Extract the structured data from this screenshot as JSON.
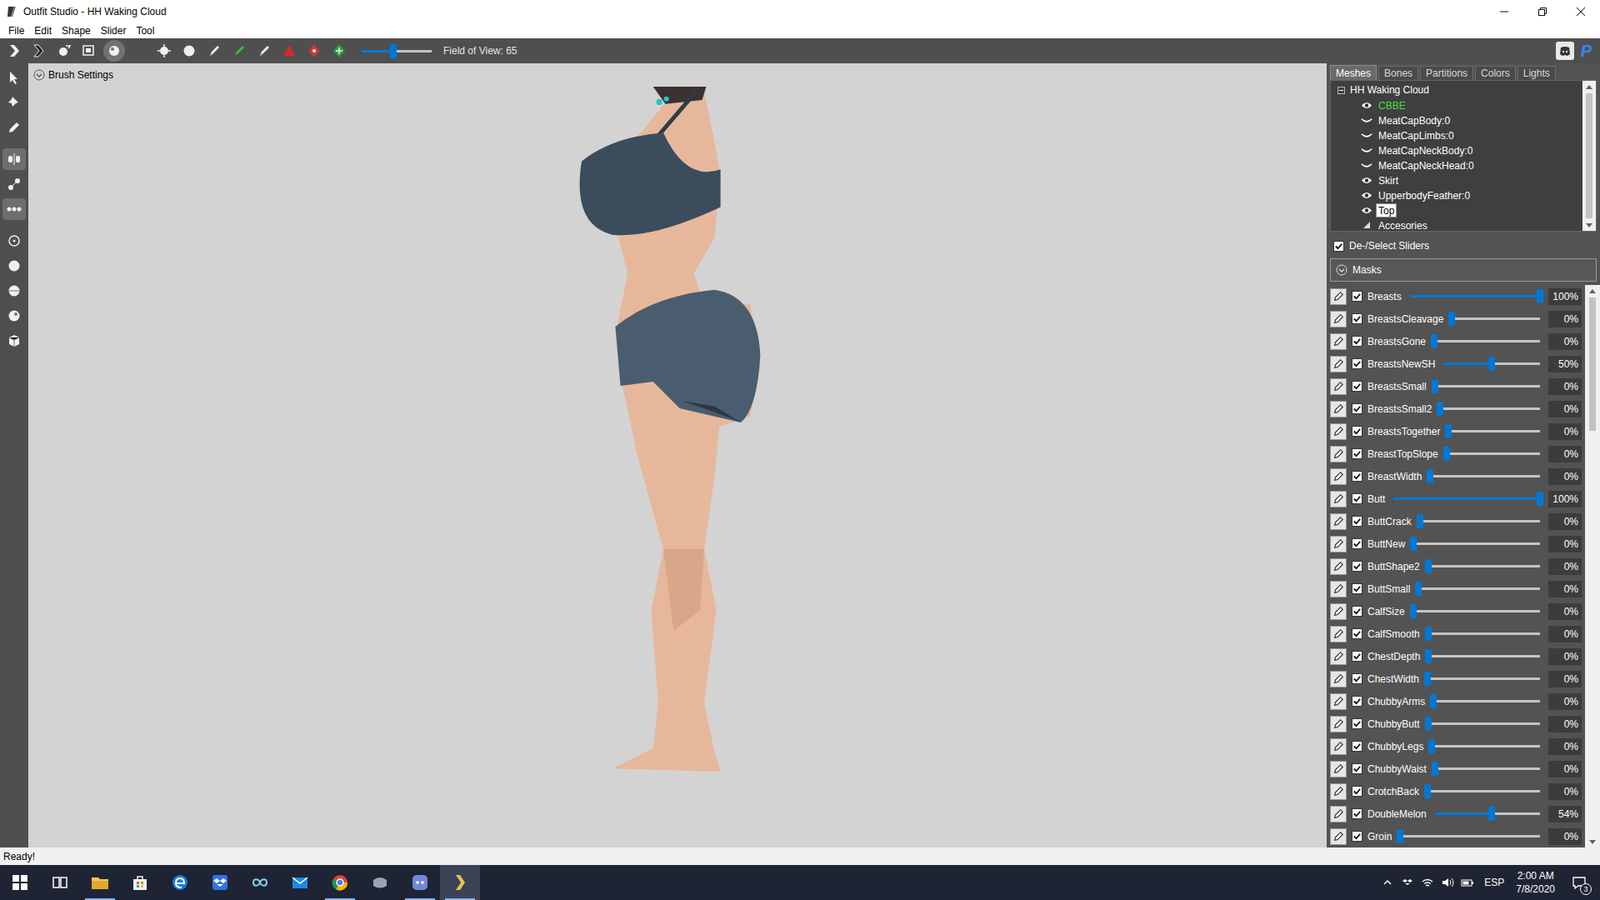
{
  "window": {
    "title": "Outfit Studio - HH Waking Cloud"
  },
  "menu": [
    {
      "label": "File"
    },
    {
      "label": "Edit"
    },
    {
      "label": "Shape"
    },
    {
      "label": "Slider"
    },
    {
      "label": "Tool"
    }
  ],
  "toolbar": {
    "tools": [
      {
        "selected": false
      },
      {
        "selected": false
      },
      {
        "selected": false
      },
      {
        "selected": false
      },
      {
        "selected": true
      },
      {
        "selected": false
      },
      {
        "selected": false
      },
      {
        "selected": false
      },
      {
        "selected": false
      },
      {
        "selected": false
      },
      {
        "selected": false
      },
      {
        "selected": false
      },
      {
        "selected": false
      },
      {
        "selected": false
      }
    ],
    "fov": {
      "level": 0.45,
      "label": "Field of View: 65"
    },
    "donate": "P"
  },
  "left_tools": [
    {
      "selected": false
    },
    {
      "selected": false
    },
    {
      "selected": false
    },
    {
      "selected": true
    },
    {
      "selected": false
    },
    {
      "selected": true
    },
    {
      "selected": false
    },
    {
      "selected": false
    },
    {
      "selected": false
    },
    {
      "selected": false
    },
    {
      "selected": false
    }
  ],
  "viewport": {
    "brush_settings": {
      "label": "Brush Settings",
      "expanded": false
    }
  },
  "panel": {
    "tabs": [
      {
        "label": "Meshes",
        "selected": true
      },
      {
        "label": "Bones",
        "selected": false
      },
      {
        "label": "Partitions",
        "selected": false
      },
      {
        "label": "Colors",
        "selected": false
      },
      {
        "label": "Lights",
        "selected": false
      }
    ],
    "tree": {
      "root": {
        "label": "HH Waking Cloud",
        "expanded": true
      },
      "items": [
        {
          "label": "CBBE",
          "kind": "mesh",
          "visible": true,
          "reference": true,
          "selected": false
        },
        {
          "label": "MeatCapBody:0",
          "kind": "mesh",
          "visible": false,
          "reference": false,
          "selected": false
        },
        {
          "label": "MeatCapLimbs:0",
          "kind": "mesh",
          "visible": false,
          "reference": false,
          "selected": false
        },
        {
          "label": "MeatCapNeckBody:0",
          "kind": "mesh",
          "visible": false,
          "reference": false,
          "selected": false
        },
        {
          "label": "MeatCapNeckHead:0",
          "kind": "mesh",
          "visible": false,
          "reference": false,
          "selected": false
        },
        {
          "label": "Skirt",
          "kind": "mesh",
          "visible": true,
          "reference": false,
          "selected": false
        },
        {
          "label": "UpperbodyFeather:0",
          "kind": "mesh",
          "visible": true,
          "reference": false,
          "selected": false
        },
        {
          "label": "Top",
          "kind": "mesh",
          "visible": true,
          "reference": false,
          "selected": true
        },
        {
          "label": "Accesories",
          "kind": "group",
          "visible": false,
          "reference": false,
          "selected": false
        }
      ]
    },
    "select_all": {
      "label": "De-/Select Sliders",
      "checked": true
    },
    "masks": {
      "label": "Masks",
      "expanded": false
    },
    "sliders": [
      {
        "name": "Breasts",
        "checked": true,
        "level": 1.0,
        "reading": "100%"
      },
      {
        "name": "BreastsCleavage",
        "checked": true,
        "level": 0,
        "reading": "0%"
      },
      {
        "name": "BreastsGone",
        "checked": true,
        "level": 0,
        "reading": "0%"
      },
      {
        "name": "BreastsNewSH",
        "checked": true,
        "level": 0.5,
        "reading": "50%"
      },
      {
        "name": "BreastsSmall",
        "checked": true,
        "level": 0,
        "reading": "0%"
      },
      {
        "name": "BreastsSmall2",
        "checked": true,
        "level": 0,
        "reading": "0%"
      },
      {
        "name": "BreastsTogether",
        "checked": true,
        "level": 0,
        "reading": "0%"
      },
      {
        "name": "BreastTopSlope",
        "checked": true,
        "level": 0,
        "reading": "0%"
      },
      {
        "name": "BreastWidth",
        "checked": true,
        "level": 0,
        "reading": "0%"
      },
      {
        "name": "Butt",
        "checked": true,
        "level": 1.0,
        "reading": "100%"
      },
      {
        "name": "ButtCrack",
        "checked": true,
        "level": 0,
        "reading": "0%"
      },
      {
        "name": "ButtNew",
        "checked": true,
        "level": 0,
        "reading": "0%"
      },
      {
        "name": "ButtShape2",
        "checked": true,
        "level": 0,
        "reading": "0%"
      },
      {
        "name": "ButtSmall",
        "checked": true,
        "level": 0,
        "reading": "0%"
      },
      {
        "name": "CalfSize",
        "checked": true,
        "level": 0,
        "reading": "0%"
      },
      {
        "name": "CalfSmooth",
        "checked": true,
        "level": 0,
        "reading": "0%"
      },
      {
        "name": "ChestDepth",
        "checked": true,
        "level": 0,
        "reading": "0%"
      },
      {
        "name": "ChestWidth",
        "checked": true,
        "level": 0,
        "reading": "0%"
      },
      {
        "name": "ChubbyArms",
        "checked": true,
        "level": 0,
        "reading": "0%"
      },
      {
        "name": "ChubbyButt",
        "checked": true,
        "level": 0,
        "reading": "0%"
      },
      {
        "name": "ChubbyLegs",
        "checked": true,
        "level": 0,
        "reading": "0%"
      },
      {
        "name": "ChubbyWaist",
        "checked": true,
        "level": 0,
        "reading": "0%"
      },
      {
        "name": "CrotchBack",
        "checked": true,
        "level": 0,
        "reading": "0%"
      },
      {
        "name": "DoubleMelon",
        "checked": true,
        "level": 0.54,
        "reading": "54%"
      },
      {
        "name": "Groin",
        "checked": true,
        "level": 0,
        "reading": "0%"
      }
    ]
  },
  "status_bar": {
    "text": "Ready!"
  },
  "taskbar": {
    "apps": [
      {
        "active": false,
        "selected": false
      },
      {
        "active": false,
        "selected": false
      },
      {
        "active": true,
        "selected": false
      },
      {
        "active": false,
        "selected": false
      },
      {
        "active": false,
        "selected": false
      },
      {
        "active": false,
        "selected": false
      },
      {
        "active": false,
        "selected": false
      },
      {
        "active": false,
        "selected": false
      },
      {
        "active": true,
        "selected": false
      },
      {
        "active": false,
        "selected": false
      },
      {
        "active": true,
        "selected": false
      },
      {
        "active": true,
        "selected": true
      }
    ],
    "tray": {
      "language": "ESP",
      "time": "2:00 AM",
      "date": "7/8/2020",
      "notifications": "3"
    }
  }
}
